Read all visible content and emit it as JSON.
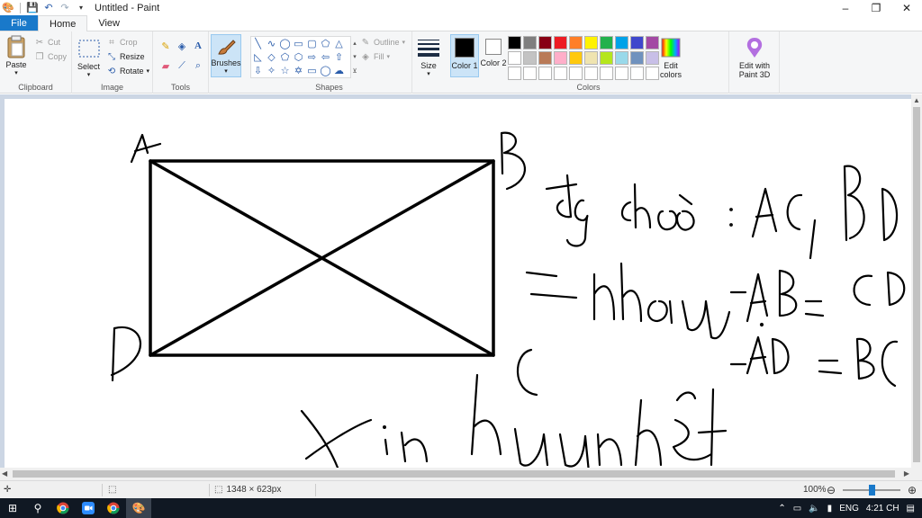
{
  "window": {
    "title": "Untitled - Paint",
    "controls": {
      "minimize": "–",
      "maximize": "❐",
      "close": "✕"
    }
  },
  "tabs": {
    "file": "File",
    "home": "Home",
    "view": "View"
  },
  "ribbon": {
    "clipboard": {
      "label": "Clipboard",
      "paste": "Paste",
      "cut": "Cut",
      "copy": "Copy"
    },
    "image": {
      "label": "Image",
      "select": "Select",
      "crop": "Crop",
      "resize": "Resize",
      "rotate": "Rotate"
    },
    "tools": {
      "label": "Tools"
    },
    "brushes": {
      "label": "Brushes"
    },
    "shapes": {
      "label": "Shapes",
      "outline": "Outline",
      "fill": "Fill"
    },
    "size": {
      "label": "Size"
    },
    "colors": {
      "label": "Colors",
      "color1_label": "Color 1",
      "color2_label": "Color 2",
      "color1_value": "#000000",
      "color2_value": "#ffffff",
      "edit_colors": "Edit colors",
      "paint3d": "Edit with Paint 3D",
      "palette": [
        "#000000",
        "#7f7f7f",
        "#880015",
        "#ed1c24",
        "#ff7f27",
        "#fff200",
        "#22b14c",
        "#00a2e8",
        "#3f48cc",
        "#a349a4",
        "#ffffff",
        "#c3c3c3",
        "#b97a57",
        "#ffaec9",
        "#ffc90e",
        "#efe4b0",
        "#b5e61d",
        "#99d9ea",
        "#7092be",
        "#c8bfe7",
        "#ffffff",
        "#ffffff",
        "#ffffff",
        "#ffffff",
        "#ffffff",
        "#ffffff",
        "#ffffff",
        "#ffffff",
        "#ffffff",
        "#ffffff"
      ]
    }
  },
  "statusbar": {
    "dimensions": "1348 × 623px",
    "zoom": "100%"
  },
  "taskbar": {
    "language": "ENG",
    "time": "4:21 CH"
  }
}
